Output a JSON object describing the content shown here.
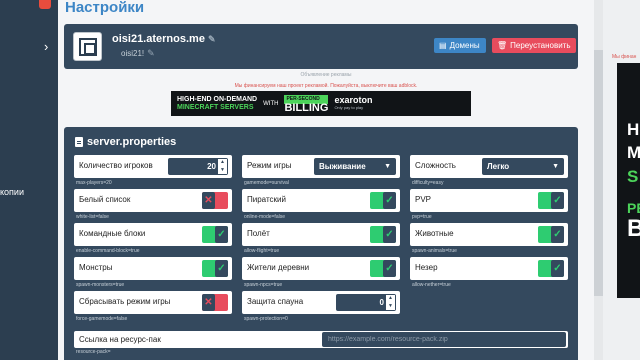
{
  "sidebar": {
    "chevron": "›",
    "partial_label": "копии"
  },
  "page": {
    "title": "Настройки"
  },
  "server": {
    "address": "oisi21.aternos.me",
    "motd": "oisi21!",
    "edit_icon": "pencil-icon",
    "domains_label": "Домены",
    "reinstall_label": "Переустановить"
  },
  "ads": {
    "label": "Объявление рекламы",
    "notice": "Мы финансируем наш проект рекламой. Пожалуйста, выключите ваш adblock.",
    "banner": {
      "line1": "HIGH-END ON-DEMAND",
      "line2": "MINECRAFT SERVERS",
      "with": "WITH",
      "tag": "PER-SECOND",
      "billing": "BILLING",
      "brand": "exaroton",
      "brand_tagline": "Only pay to play"
    },
    "side_note": "Мы финан",
    "side_banner": {
      "t1": "HIG",
      "t2": "M",
      "t3": "S",
      "t4": "PE",
      "t5": "B"
    }
  },
  "properties": {
    "title": "server.properties",
    "items": [
      {
        "label": "Количество игроков",
        "key": "max-players=20",
        "kind": "number",
        "value": "20"
      },
      {
        "label": "Режим игры",
        "key": "gamemode=survival",
        "kind": "select",
        "value": "Выживание"
      },
      {
        "label": "Сложность",
        "key": "difficulty=easy",
        "kind": "select",
        "value": "Легко"
      },
      {
        "label": "Белый список",
        "key": "white-list=false",
        "kind": "toggle",
        "on": false
      },
      {
        "label": "Пиратский",
        "key": "online-mode=false",
        "kind": "toggle",
        "on": true
      },
      {
        "label": "PVP",
        "key": "pvp=true",
        "kind": "toggle",
        "on": true
      },
      {
        "label": "Командные блоки",
        "key": "enable-command-block=true",
        "kind": "toggle",
        "on": true
      },
      {
        "label": "Полёт",
        "key": "allow-flight=true",
        "kind": "toggle",
        "on": true
      },
      {
        "label": "Животные",
        "key": "spawn-animals=true",
        "kind": "toggle",
        "on": true
      },
      {
        "label": "Монстры",
        "key": "spawn-monsters=true",
        "kind": "toggle",
        "on": true
      },
      {
        "label": "Жители деревни",
        "key": "spawn-npcs=true",
        "kind": "toggle",
        "on": true
      },
      {
        "label": "Незер",
        "key": "allow-nether=true",
        "kind": "toggle",
        "on": true
      },
      {
        "label": "Сбрасывать режим игры",
        "key": "force-gamemode=false",
        "kind": "toggle",
        "on": false
      },
      {
        "label": "Защита спауна",
        "key": "spawn-protection=0",
        "kind": "number",
        "value": "0"
      }
    ],
    "resource_pack": {
      "label": "Ссылка на ресурс-пак",
      "key": "resource-pack=",
      "placeholder": "https://example.com/resource-pack.zip"
    }
  },
  "colors": {
    "accent": "#3d86c6",
    "panel": "#34495e",
    "on": "#2ecc71",
    "off": "#e84c5d"
  }
}
